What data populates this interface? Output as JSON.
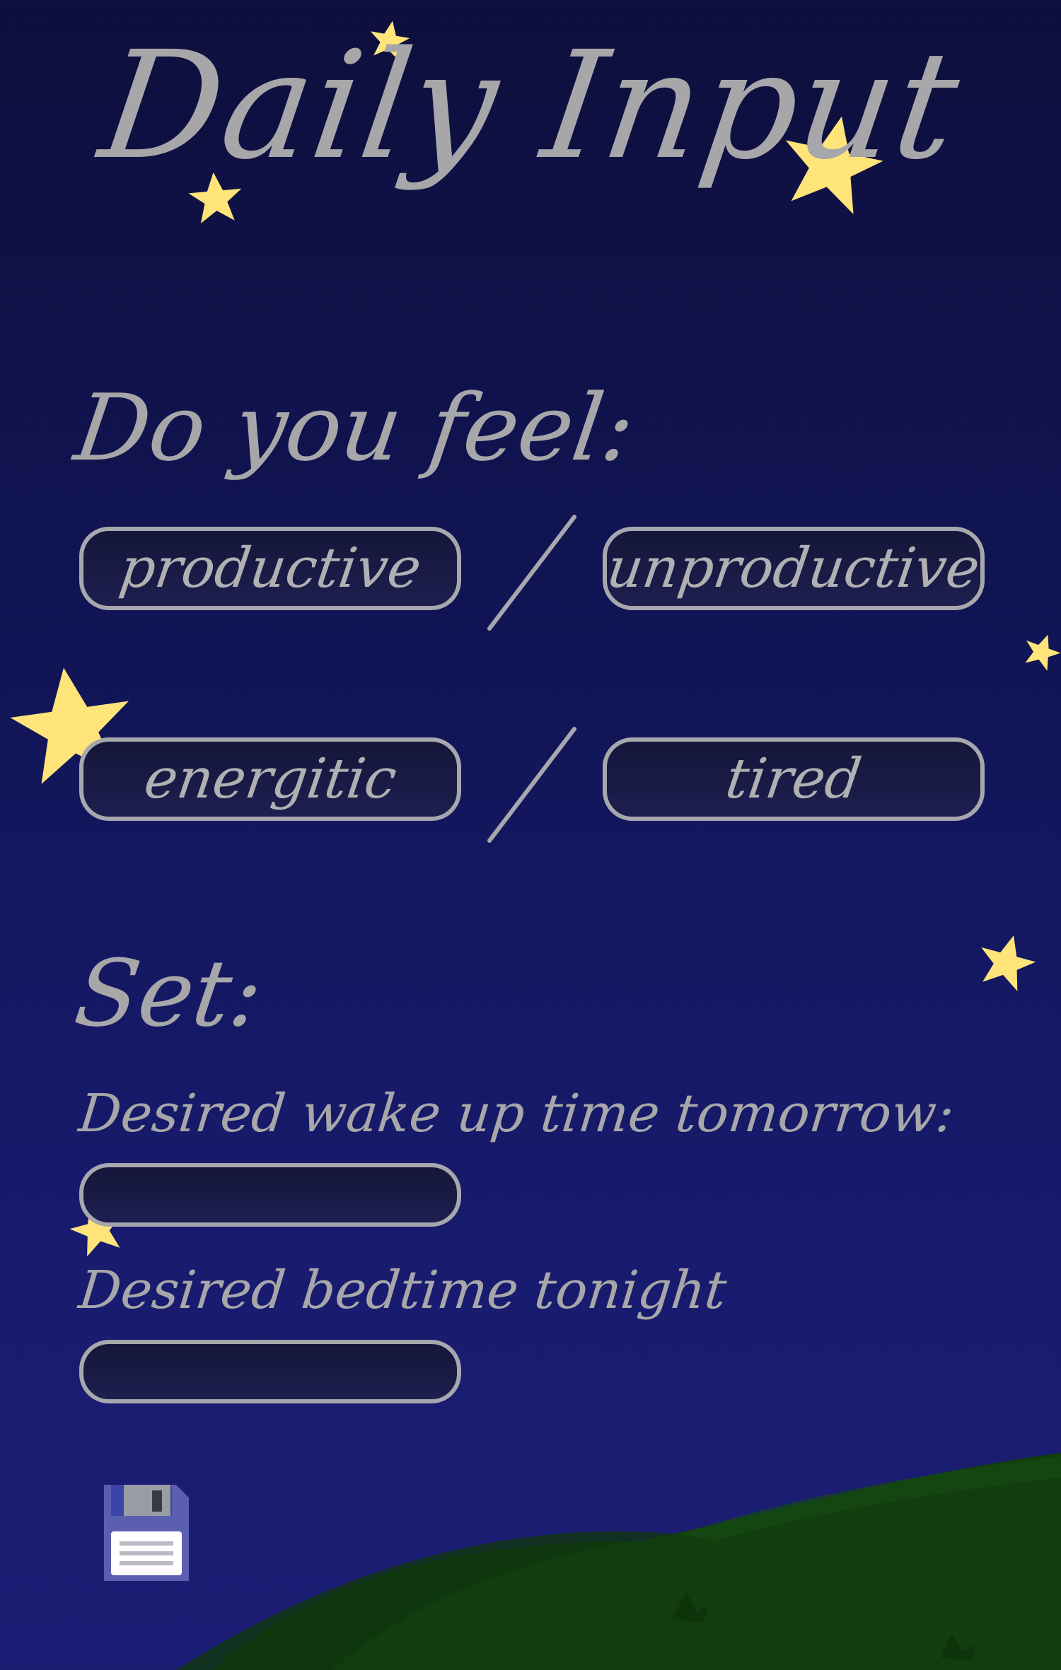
{
  "page": {
    "title": "Daily Input"
  },
  "feel": {
    "heading": "Do you feel:",
    "pairs": [
      {
        "left": "productive",
        "right": "unproductive"
      },
      {
        "left": "energitic",
        "right": "tired"
      }
    ]
  },
  "set": {
    "heading": "Set:",
    "wake_label": "Desired wake up time tomorrow:",
    "wake_value": "",
    "bed_label": "Desired bedtime tonight",
    "bed_value": ""
  },
  "colors": {
    "star": "#ffe47a",
    "text": "#a7a7aa",
    "hill": "#123e0f",
    "sky_top": "#0e0f3d",
    "sky_bottom": "#1b1e74"
  },
  "icons": {
    "save": "floppy-disk-icon",
    "decor": "star-icon"
  }
}
